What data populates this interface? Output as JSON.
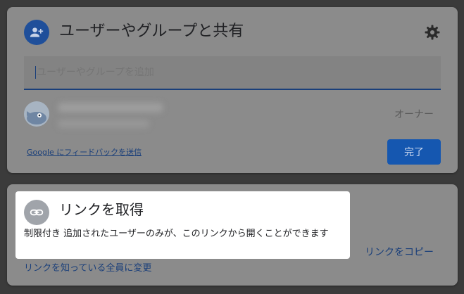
{
  "share": {
    "title": "ユーザーやグループと共有",
    "input_placeholder": "ユーザーやグループを追加",
    "owner_role": "オーナー",
    "feedback_link": "Google にフィードバックを送信",
    "done_label": "完了"
  },
  "link": {
    "title": "リンクを取得",
    "description": "制限付き 追加されたユーザーのみが、このリンクから開くことができます",
    "copy_label": "リンクをコピー",
    "change_label": "リンクを知っている全員に変更"
  },
  "colors": {
    "accent": "#1a73e8",
    "done_button": "#1557b0",
    "highlight": "#ffffff"
  },
  "icons": [
    "add-person-icon",
    "gear-icon",
    "link-icon"
  ]
}
